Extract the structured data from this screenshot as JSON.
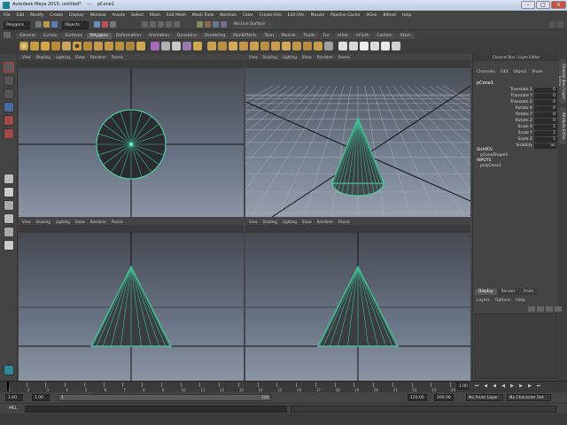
{
  "titlebar": {
    "title": "Autodesk Maya 2015: untitled*    ---    pCone1"
  },
  "menubar": {
    "items": [
      "File",
      "Edit",
      "Modify",
      "Create",
      "Display",
      "Window",
      "Assets",
      "Select",
      "Mesh",
      "Edit Mesh",
      "Mesh Tools",
      "Normals",
      "Color",
      "Create UVs",
      "Edit UVs",
      "Muscle",
      "Pipeline Cache",
      "XGen",
      "Bifrost",
      "Help"
    ]
  },
  "statusline": {
    "mode": "Polygons",
    "objects": "Objects",
    "live_surface": "No Live Surface"
  },
  "shelf": {
    "tabs": [
      "General",
      "Curves",
      "Surfaces",
      "Polygons",
      "Deformation",
      "Animation",
      "Dynamics",
      "Rendering",
      "PaintEffects",
      "Toon",
      "Muscle",
      "Fluids",
      "Fur",
      "nHair",
      "nCloth",
      "Custom",
      "XGen"
    ],
    "active_tab": "Polygons"
  },
  "viewport": {
    "menus": [
      "View",
      "Shading",
      "Lighting",
      "Show",
      "Renderer",
      "Panels"
    ]
  },
  "channel_box": {
    "header": "Channel Box / Layer Editor",
    "menus": [
      "Channels",
      "Edit",
      "Object",
      "Show"
    ],
    "object": "pCone1",
    "attributes": [
      {
        "name": "Translate X",
        "value": "0"
      },
      {
        "name": "Translate Y",
        "value": "0"
      },
      {
        "name": "Translate Z",
        "value": "0"
      },
      {
        "name": "Rotate X",
        "value": "0"
      },
      {
        "name": "Rotate Y",
        "value": "0"
      },
      {
        "name": "Rotate Z",
        "value": "0"
      },
      {
        "name": "Scale X",
        "value": "1"
      },
      {
        "name": "Scale Y",
        "value": "1"
      },
      {
        "name": "Scale Z",
        "value": "1"
      },
      {
        "name": "Visibility",
        "value": "on"
      }
    ],
    "shapes_label": "SHAPES",
    "shape_item": "pConeShape1",
    "inputs_label": "INPUTS",
    "input_item": "polyCone1"
  },
  "side_tabs": [
    "Channel Box / Layer Editor",
    "Attribute Editor"
  ],
  "layer_editor": {
    "tabs": [
      "Display",
      "Render",
      "Anim"
    ],
    "active_tab": "Display",
    "menus": [
      "Layers",
      "Options",
      "Help"
    ]
  },
  "timeline": {
    "ticks": [
      "1",
      "2",
      "3",
      "4",
      "5",
      "6",
      "7",
      "8",
      "9",
      "10",
      "11",
      "12",
      "13",
      "14",
      "15",
      "16",
      "17",
      "18",
      "19",
      "20",
      "21",
      "22",
      "23",
      "24"
    ],
    "current_frame": "1.00"
  },
  "range": {
    "start": "1.00",
    "playback_start": "1.00",
    "handle_start": "1",
    "handle_end": "120",
    "playback_end": "120.00",
    "end": "200.00",
    "anim_layer": "No Anim Layer",
    "char_set": "No Character Set"
  },
  "cmdline": {
    "label": "MEL"
  }
}
